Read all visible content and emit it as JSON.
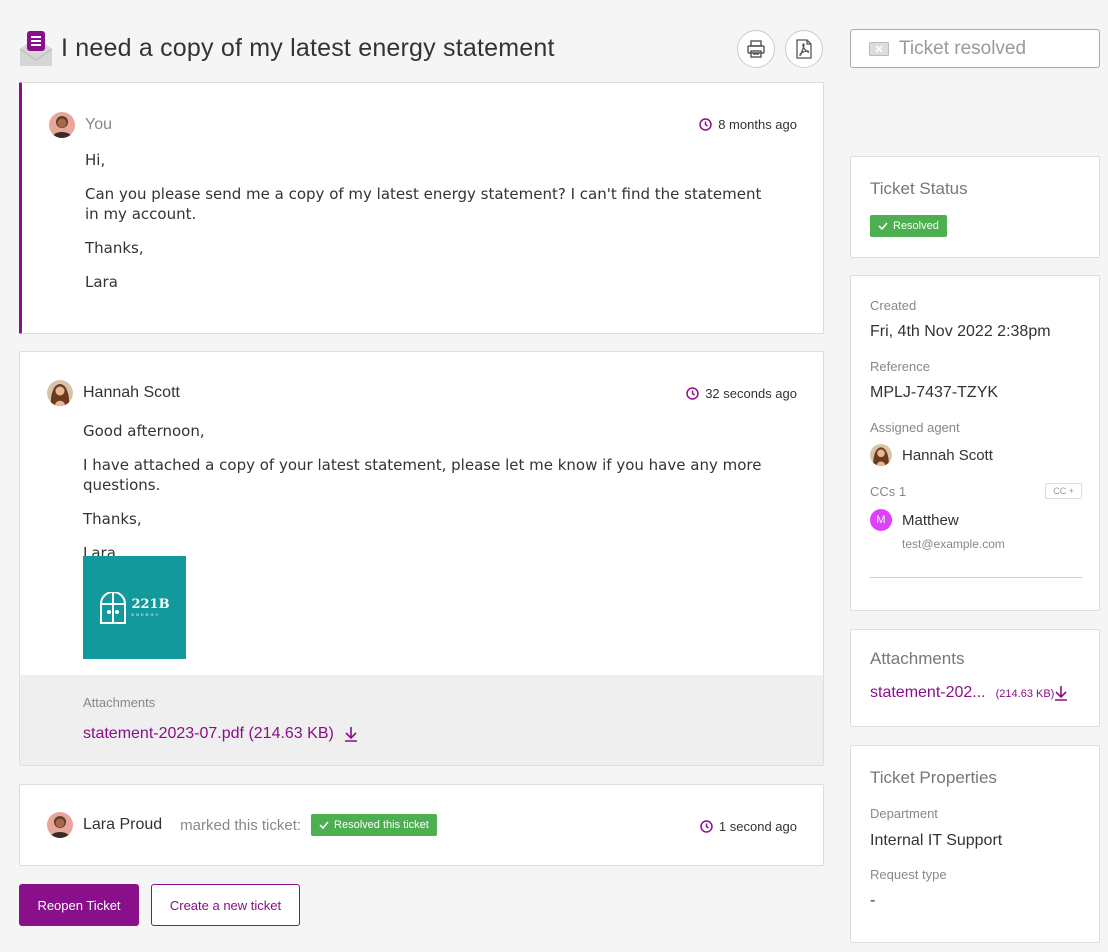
{
  "header": {
    "title": "I need a copy of my latest energy statement",
    "print_icon": "print-icon",
    "pdf_icon": "pdf-icon",
    "resolved_button": "Ticket resolved"
  },
  "messages": [
    {
      "author": "You",
      "time": "8 months ago",
      "paragraphs": [
        "Hi,",
        "Can you please send me a copy of my latest energy statement? I can't find the statement in my account.",
        "Thanks,",
        "Lara"
      ]
    },
    {
      "author": "Hannah Scott",
      "time": "32 seconds ago",
      "paragraphs": [
        "Good afternoon,",
        "I have attached a copy of your latest statement, please let me know if you have any more questions.",
        "Thanks,",
        "Lara"
      ],
      "image_logo_text": "221B",
      "image_logo_sub": "ENERGY",
      "attachments_label": "Attachments",
      "attachment": "statement-2023-07.pdf (214.63 KB)"
    },
    {
      "author": "Lara Proud",
      "action": "marked this ticket:",
      "badge": "Resolved this ticket",
      "time": "1 second ago"
    }
  ],
  "actions": {
    "reopen": "Reopen Ticket",
    "create_new": "Create a new ticket"
  },
  "sidebar": {
    "status": {
      "title": "Ticket Status",
      "badge": "Resolved"
    },
    "details": {
      "created_label": "Created",
      "created_value": "Fri, 4th Nov 2022 2:38pm",
      "reference_label": "Reference",
      "reference_value": "MPLJ-7437-TZYK",
      "agent_label": "Assigned agent",
      "agent_value": "Hannah Scott",
      "ccs_label": "CCs 1",
      "cc_button": "CC +",
      "cc_initial": "M",
      "cc_name": "Matthew",
      "cc_email": "test@example.com"
    },
    "attachments": {
      "title": "Attachments",
      "file": "statement-202...",
      "size": "(214.63 KB)"
    },
    "properties": {
      "title": "Ticket Properties",
      "department_label": "Department",
      "department_value": "Internal IT Support",
      "request_type_label": "Request type",
      "request_type_value": "-"
    }
  },
  "colors": {
    "brand": "#8a0f8a",
    "success": "#4caf50",
    "logo_bg": "#12999b",
    "cc_avatar": "#e040fb"
  }
}
